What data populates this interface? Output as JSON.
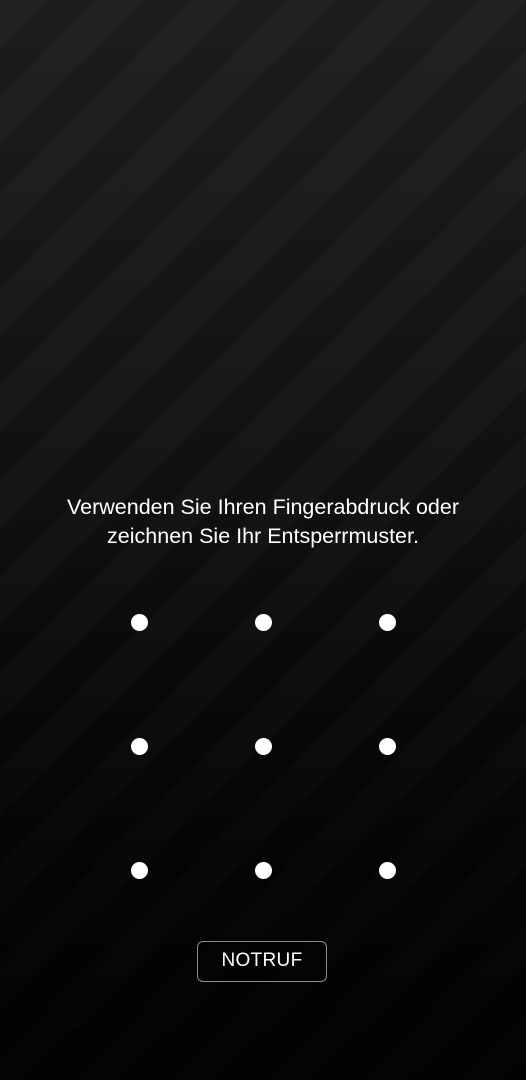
{
  "lock_screen": {
    "prompt_line_1": "Verwenden Sie Ihren Fingerabdruck oder",
    "prompt_line_2": "zeichnen Sie Ihr Entsperrmuster.",
    "pattern": {
      "rows": 3,
      "columns": 3,
      "dot_color": "#ffffff"
    },
    "emergency_button_label": "NOTRUF"
  },
  "colors": {
    "background": "#111111",
    "text": "#ffffff",
    "button_border": "#8c8c8c"
  }
}
